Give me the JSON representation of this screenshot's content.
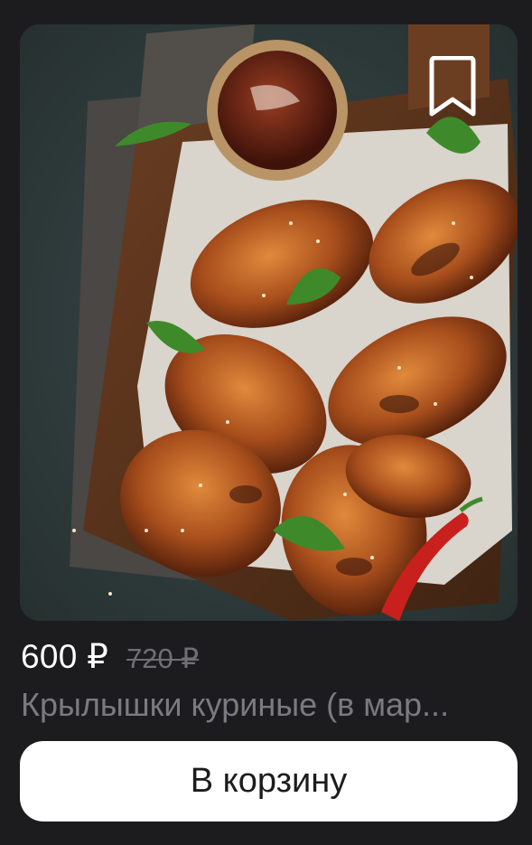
{
  "product": {
    "image": {
      "description_icon": "food-photo",
      "bookmark_icon": "bookmark-icon"
    },
    "price_current": "600 ₽",
    "price_old": "720 ₽",
    "name": "Крылышки куриные (в мар..."
  },
  "actions": {
    "cart_button_label": "В корзину"
  },
  "colors": {
    "background": "#1c1c1e",
    "button_bg": "#ffffff",
    "price": "#ffffff",
    "muted": "#7a7a80"
  }
}
